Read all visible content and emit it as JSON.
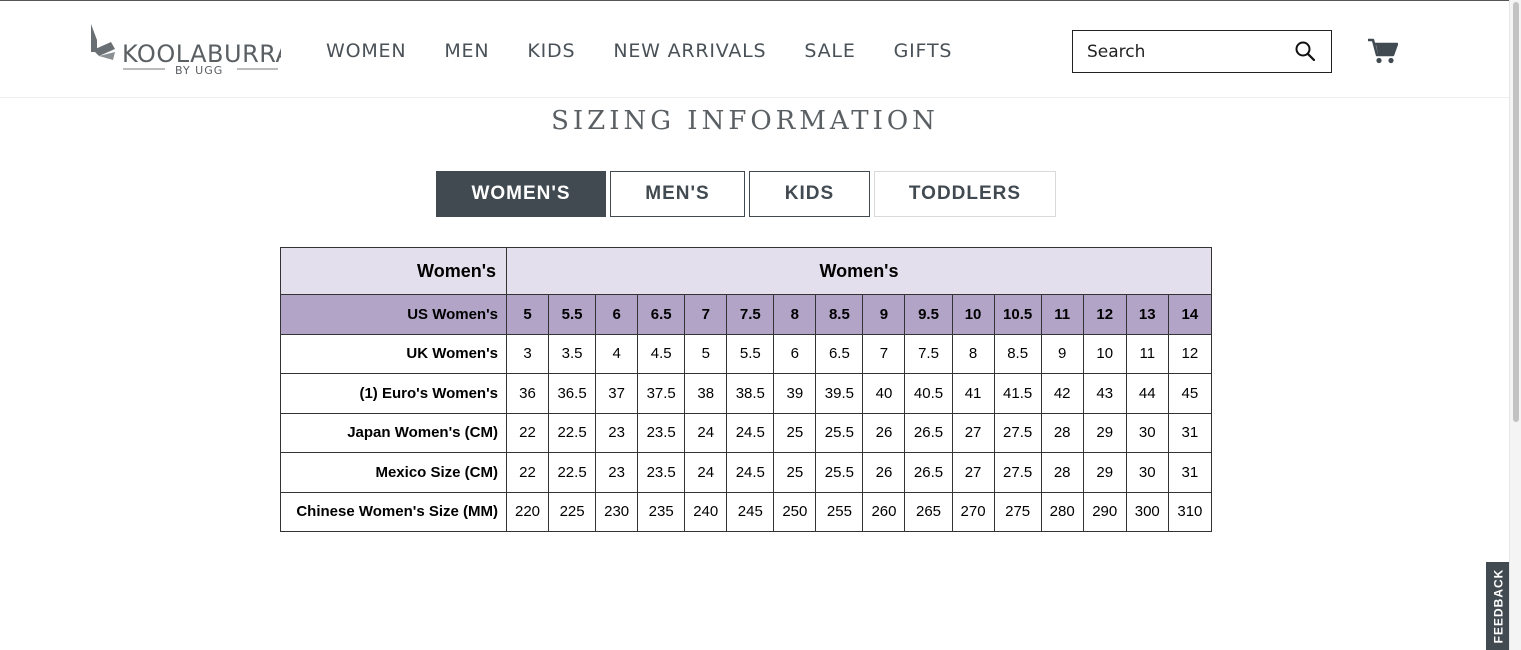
{
  "brand": {
    "name": "KOOLABURRA",
    "sub": "BY UGG"
  },
  "nav": [
    "WOMEN",
    "MEN",
    "KIDS",
    "NEW ARRIVALS",
    "SALE",
    "GIFTS"
  ],
  "search": {
    "placeholder": "Search",
    "icon": "search-icon"
  },
  "cart": {
    "icon": "cart-icon"
  },
  "page_title": "SIZING INFORMATION",
  "tabs": [
    {
      "label": "WOMEN'S",
      "active": true
    },
    {
      "label": "MEN'S",
      "active": false
    },
    {
      "label": "KIDS",
      "active": false
    },
    {
      "label": "TODDLERS",
      "active": false
    }
  ],
  "table": {
    "corner": "Women's",
    "group_header": "Women's",
    "rows": [
      {
        "label": "US Women's",
        "values": [
          "5",
          "5.5",
          "6",
          "6.5",
          "7",
          "7.5",
          "8",
          "8.5",
          "9",
          "9.5",
          "10",
          "10.5",
          "11",
          "12",
          "13",
          "14"
        ]
      },
      {
        "label": "UK Women's",
        "values": [
          "3",
          "3.5",
          "4",
          "4.5",
          "5",
          "5.5",
          "6",
          "6.5",
          "7",
          "7.5",
          "8",
          "8.5",
          "9",
          "10",
          "11",
          "12"
        ]
      },
      {
        "label": "(1) Euro's Women's",
        "values": [
          "36",
          "36.5",
          "37",
          "37.5",
          "38",
          "38.5",
          "39",
          "39.5",
          "40",
          "40.5",
          "41",
          "41.5",
          "42",
          "43",
          "44",
          "45"
        ]
      },
      {
        "label": "Japan Women's (CM)",
        "values": [
          "22",
          "22.5",
          "23",
          "23.5",
          "24",
          "24.5",
          "25",
          "25.5",
          "26",
          "26.5",
          "27",
          "27.5",
          "28",
          "29",
          "30",
          "31"
        ]
      },
      {
        "label": "Mexico Size (CM)",
        "values": [
          "22",
          "22.5",
          "23",
          "23.5",
          "24",
          "24.5",
          "25",
          "25.5",
          "26",
          "26.5",
          "27",
          "27.5",
          "28",
          "29",
          "30",
          "31"
        ]
      },
      {
        "label": "Chinese Women's Size (MM)",
        "values": [
          "220",
          "225",
          "230",
          "235",
          "240",
          "245",
          "250",
          "255",
          "260",
          "265",
          "270",
          "275",
          "280",
          "290",
          "300",
          "310"
        ]
      }
    ]
  },
  "feedback": "FEEDBACK",
  "colors": {
    "tab_active": "#414a50",
    "header_row": "#e3dfed",
    "us_row": "#b2a4c7"
  }
}
